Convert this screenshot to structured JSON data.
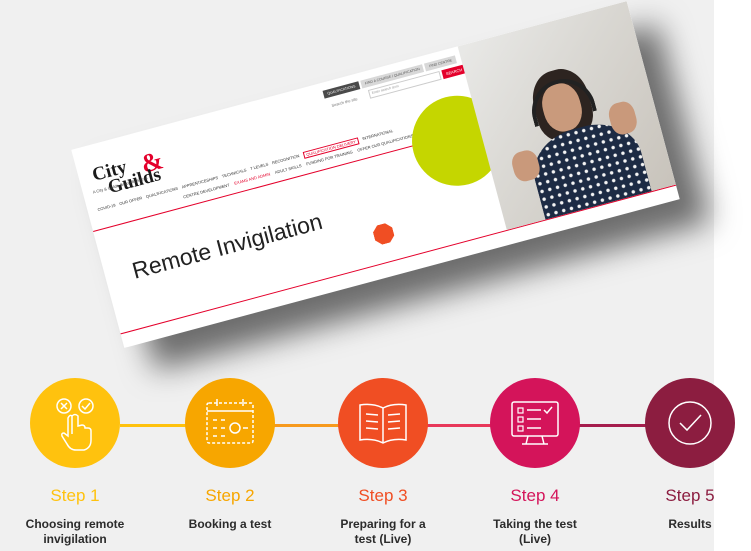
{
  "website": {
    "logo_line1": "City",
    "logo_line2": "Guilds",
    "logo_tagline": "A City & Guilds Group Business",
    "topbar": [
      "QUALIFICATIONS",
      "FIND A COURSE / QUALIFICATION",
      "FIND CENTRE"
    ],
    "search_label": "Search the site",
    "search_placeholder": "Enter search term",
    "search_button": "SEARCH",
    "nav_main": [
      "COVID-19",
      "OUR OFFER",
      "QUALIFICATIONS",
      "APPRENTICESHIPS",
      "TECHNICALS",
      "T LEVELS",
      "RECOGNITION",
      "QUALIFICATION DELIVERY",
      "INTERNATIONAL"
    ],
    "nav_sub": [
      "CENTRE DEVELOPMENT",
      "EXAMS AND ADMIN",
      "ADULT SKILLS",
      "FUNDING FOR TRAINING",
      "OFFER OUR QUALIFICATIONS"
    ],
    "hero_title": "Remote Invigilation"
  },
  "steps": [
    {
      "label": "Step 1",
      "desc": "Choosing remote\ninvigilation",
      "color": "#ffc20e",
      "icon": "hand-pointer-icon"
    },
    {
      "label": "Step 2",
      "desc": "Booking a test",
      "color": "#f7a600",
      "icon": "calendar-icon"
    },
    {
      "label": "Step 3",
      "desc": "Preparing for a\ntest (Live)",
      "color": "#f04e23",
      "icon": "book-icon"
    },
    {
      "label": "Step 4",
      "desc": "Taking the test\n(Live)",
      "color": "#d4145a",
      "icon": "monitor-checklist-icon"
    },
    {
      "label": "Step 5",
      "desc": "Results",
      "color": "#8c1d40",
      "icon": "checkmark-circle-icon"
    }
  ],
  "colors": {
    "brand_red": "#e4002b",
    "green_circle": "#c5d600",
    "octagon": "#f04e23"
  }
}
